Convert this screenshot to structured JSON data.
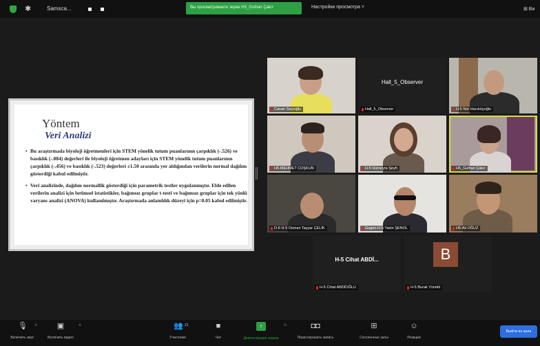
{
  "topbar": {
    "host_name": "Samsca...",
    "share_banner": "Вы просматриваете экран H5_Gulhan Çakır",
    "view_options": "Настройки просмотра ˅",
    "view_label": "⊞ Ви"
  },
  "slide": {
    "title": "Yöntem",
    "subtitle": "Veri Analizi",
    "bullets": [
      "Bu araştırmada biyoloji öğretmenleri için STEM yönelik tutum puanlarının çarpıklık (-.526) ve basıklık (-.084) değerleri ile biyoloji öğretmen adayları için STEM yönelik tutum puanlarının çarpıklık (-.456) ve basıklık (-.523) değerleri ±1.50 arasında yer aldığından verilerin normal dağılım gösterdiği kabul edilmiştir.",
      "Veri analizinde, dağılım normallik gösterdiği için parametrik testler uygulanmıştır. Elde edilen verilerin analizi için betimsel istatistikler, bağımsız gruplar t-testi ve bağımsız gruplar için tek yönlü varyans analizi (ANOVA) kullanılmıştır. Araştırmada anlamlılık düzeyi için p=0.05 kabul edilmiştir."
    ]
  },
  "participants": [
    {
      "label": "Canan Saçıoğlu"
    },
    {
      "label": "Hall_5_Observer",
      "display_name": "Hall_5_Observer"
    },
    {
      "label": "H-5 Nür Hacıköçoğlu"
    },
    {
      "label": "H5-MEHMET COŞKUN"
    },
    {
      "label": "H-5 Hümeyra Şeyh"
    },
    {
      "label": "H5_Gulhan Çakır"
    },
    {
      "label": "D-6 H-5 Osman Tayyar ÇELİK"
    },
    {
      "label": "Gagen H-5 Yasin ŞENOL"
    },
    {
      "label": "H5-Ali OĞUZ"
    },
    {
      "label": "H-5 Cihat ABDİOĞLU",
      "display_name": "H-5 Cihat ABDİ..."
    },
    {
      "label": "H-5 Burak Yürekli",
      "avatar_letter": "B"
    }
  ],
  "toolbar": {
    "mute": "Включить звук",
    "video": "Включить видео",
    "participants": "Участники",
    "participants_count": "21",
    "chat": "Чат",
    "share": "Демонстрация экрана",
    "record": "Пересохранить запись",
    "rooms": "Сессионные залы",
    "reactions": "Реакции",
    "leave": "Выйти из зала"
  },
  "colors": {
    "share_green": "#2ea043",
    "mic_muted": "#e02828",
    "active_speaker": "#d7e03a",
    "leave_blue": "#2d6fe0",
    "subtitle_navy": "#2a3a7a"
  }
}
